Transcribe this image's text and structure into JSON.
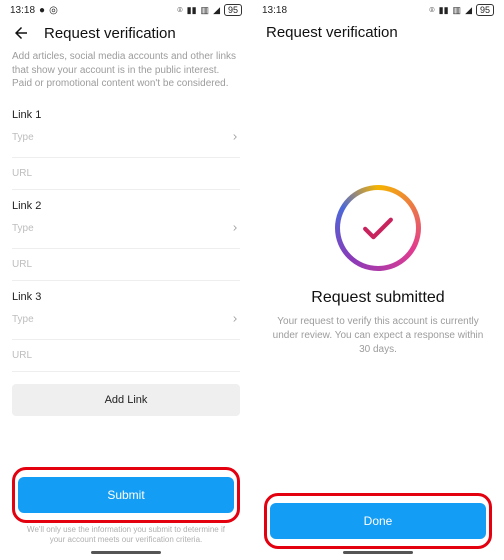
{
  "status": {
    "time": "13:18",
    "battery": "95"
  },
  "left": {
    "title": "Request verification",
    "desc": "Add articles, social media accounts and other links that show your account is in the public interest. Paid or promotional content won't be considered.",
    "link1": "Link 1",
    "link2": "Link 2",
    "link3": "Link 3",
    "type": "Type",
    "url": "URL",
    "addlink": "Add Link",
    "submit": "Submit",
    "foot": "We'll only use the information you submit to determine if your account meets our verification criteria."
  },
  "right": {
    "title": "Request verification",
    "succ_title": "Request submitted",
    "succ_desc": "Your request to verify this account is currently under review. You can expect a response within 30 days.",
    "done": "Done"
  }
}
